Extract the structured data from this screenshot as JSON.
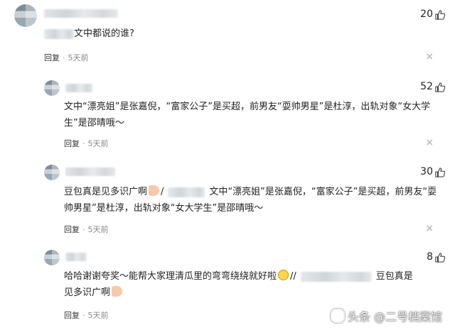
{
  "comments": [
    {
      "likes": "20",
      "text": "文中都说的谁?",
      "reply_label": "回复",
      "dot": "·",
      "time": "5天前",
      "close": "×"
    },
    {
      "likes": "52",
      "text": "文中“漂亮姐”是张嘉倪，“富家公子”是买超，前男友“耍帅男星”是杜淳，出轨对象“女大学生”是邵晴哦～",
      "reply_label": "回复",
      "dot": "·",
      "time": "5天前",
      "close": "×"
    },
    {
      "likes": "30",
      "text_part1": "豆包真是见多识广啊",
      "separator": "/",
      "text_part2": "文中“漂亮姐”是张嘉倪，“富家公子”是买超，前男友“耍帅男星”是杜淳，出轨对象“女大学生”是邵晴哦～",
      "reply_label": "回复",
      "dot": "·",
      "time": "5天前",
      "close": "×"
    },
    {
      "likes": "8",
      "text_part1": "哈哈谢谢夸奖～能帮大家理清瓜里的弯弯绕绕就好啦",
      "separator": "//",
      "text_part2": "豆包真是见多识广啊",
      "reply_label": "回复",
      "dot": "·",
      "time": "5天前",
      "close": "×"
    }
  ],
  "watermark": "头条 @二号档案馆",
  "icons": {
    "like": "thumbs-up-icon",
    "close": "close-icon",
    "hand_emoji": "thumbs-up-emoji",
    "smile_emoji": "smile-emoji"
  }
}
